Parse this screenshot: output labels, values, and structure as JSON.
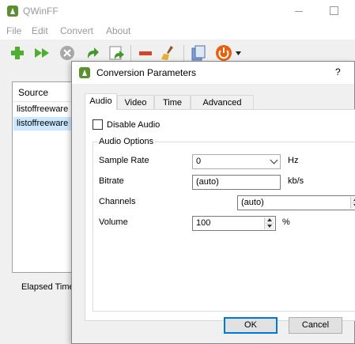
{
  "app": {
    "title": "QWinFF"
  },
  "menu": [
    "File",
    "Edit",
    "Convert",
    "About"
  ],
  "toolbar": {
    "icons": [
      "add-icon",
      "start-icon",
      "stop-icon",
      "retry-icon",
      "retry-all-icon",
      "remove-icon",
      "clear-icon",
      "file-info-icon",
      "power-icon",
      "dropdown-arrow-icon"
    ]
  },
  "source": {
    "header": "Source",
    "rows": [
      "listoffreeware",
      "listoffreeware"
    ]
  },
  "status": {
    "elapsed_label": "Elapsed Time"
  },
  "dialog": {
    "title": "Conversion Parameters",
    "help": "?",
    "tabs": [
      "Audio",
      "Video",
      "Time",
      "Advanced"
    ],
    "active_tab": "Audio",
    "disable_audio_label": "Disable Audio",
    "disable_audio_checked": false,
    "group_title": "Audio Options",
    "sample_rate_label": "Sample Rate",
    "sample_rate_value": "0",
    "sample_rate_unit": "Hz",
    "bitrate_label": "Bitrate",
    "bitrate_value": "(auto)",
    "bitrate_unit": "kb/s",
    "channels_label": "Channels",
    "channels_value": "(auto)",
    "volume_label": "Volume",
    "volume_value": "100",
    "volume_unit": "%",
    "ok_label": "OK",
    "cancel_label": "Cancel"
  },
  "colors": {
    "selection": "#cce8ff",
    "focus_border": "#0078d7",
    "add_green": "#4caf2f",
    "power_orange": "#e8600c"
  }
}
